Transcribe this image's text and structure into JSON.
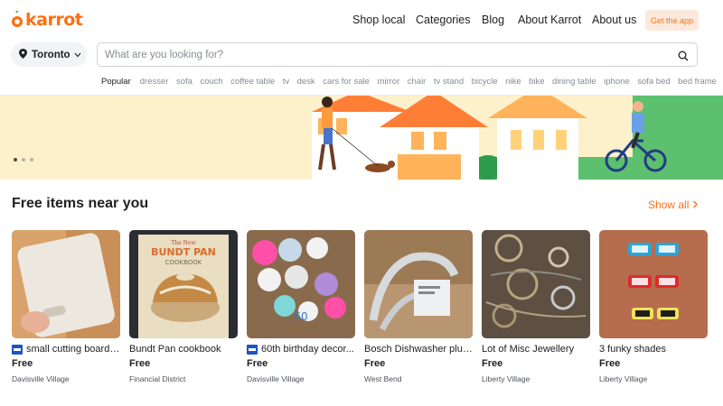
{
  "header": {
    "logo_text": "karrot",
    "nav": [
      "Shop local",
      "Categories",
      "Blog",
      "About Karrot",
      "About us"
    ],
    "get_app": "Get the app"
  },
  "search": {
    "location": "Toronto",
    "placeholder": "What are you looking for?",
    "popular_label": "Popular",
    "popular_tags": [
      "dresser",
      "sofa",
      "couch",
      "coffee table",
      "tv",
      "desk",
      "cars for sale",
      "mirror",
      "chair",
      "tv stand",
      "bicycle",
      "nike",
      "bike",
      "dining table",
      "iphone",
      "sofa bed",
      "bed frame"
    ]
  },
  "banner": {
    "slides": 3,
    "active_slide": 1
  },
  "section": {
    "title": "Free items near you",
    "show_all": "Show all"
  },
  "items": [
    {
      "title": "small cutting board ...",
      "price": "Free",
      "location": "Davisville Village",
      "flag": true
    },
    {
      "title": "Bundt Pan cookbook",
      "price": "Free",
      "location": "Financial District",
      "flag": false
    },
    {
      "title": "60th birthday decor...",
      "price": "Free",
      "location": "Davisville Village",
      "flag": true
    },
    {
      "title": "Bosch Dishwasher plug...",
      "price": "Free",
      "location": "West Bend",
      "flag": false
    },
    {
      "title": "Lot of Misc Jewellery",
      "price": "Free",
      "location": "Liberty Village",
      "flag": false
    },
    {
      "title": "3 funky shades",
      "price": "Free",
      "location": "Liberty Village",
      "flag": false
    }
  ],
  "book_cover": {
    "line1": "The New",
    "line2": "BUNDT PAN",
    "line3": "COOKBOOK"
  },
  "colors": {
    "brand": "#ff6f0f",
    "banner_bg": "#fdf1cb"
  }
}
